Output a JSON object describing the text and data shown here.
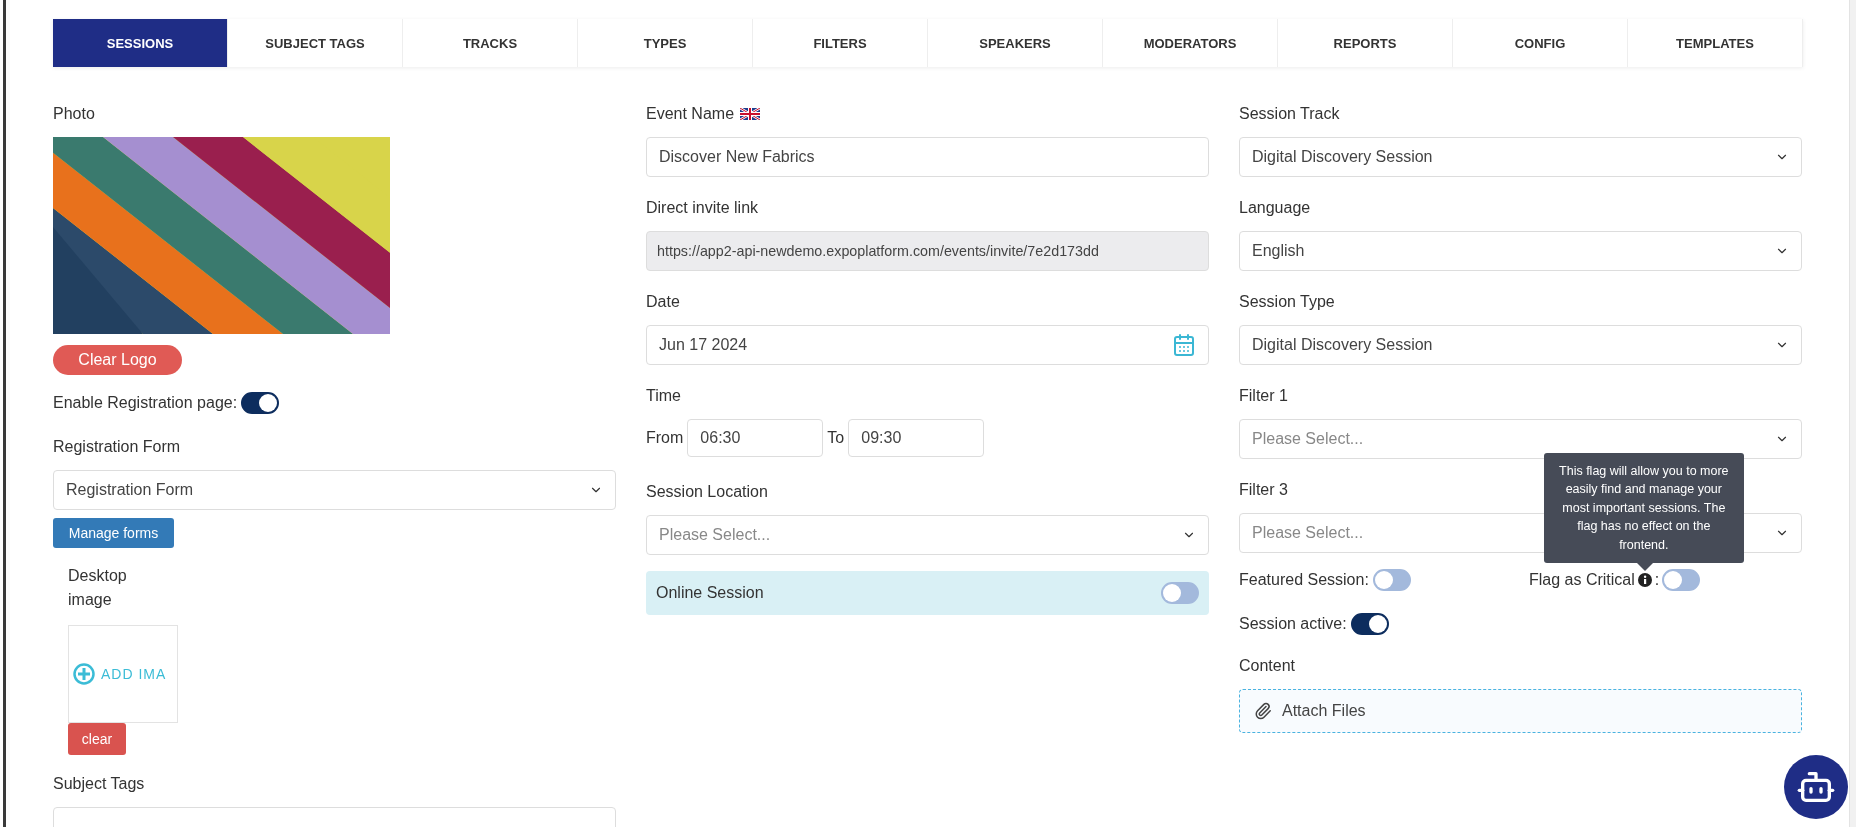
{
  "tabs": [
    {
      "label": "SESSIONS",
      "selected": true
    },
    {
      "label": "SUBJECT TAGS",
      "selected": false
    },
    {
      "label": "TRACKS",
      "selected": false
    },
    {
      "label": "TYPES",
      "selected": false
    },
    {
      "label": "FILTERS",
      "selected": false
    },
    {
      "label": "SPEAKERS",
      "selected": false
    },
    {
      "label": "MODERATORS",
      "selected": false
    },
    {
      "label": "REPORTS",
      "selected": false
    },
    {
      "label": "CONFIG",
      "selected": false
    },
    {
      "label": "TEMPLATES",
      "selected": false
    }
  ],
  "left": {
    "photo_label": "Photo",
    "clear_logo_button": "Clear Logo",
    "registration_toggle": {
      "label": "Enable Registration page:",
      "on": true
    },
    "registration_form": {
      "label": "Registration Form",
      "value": "Registration Form"
    },
    "manage_forms_button": "Manage forms",
    "desktop_image": {
      "label": "Desktop image",
      "add_text": "ADD IMA",
      "clear_button": "clear"
    },
    "subject_tags_label": "Subject Tags"
  },
  "middle": {
    "event_name": {
      "label": "Event Name",
      "value": "Discover New Fabrics"
    },
    "invite_link": {
      "label": "Direct invite link",
      "value": "https://app2-api-newdemo.expoplatform.com/events/invite/7e2d173dd"
    },
    "date": {
      "label": "Date",
      "value": "Jun 17 2024"
    },
    "time": {
      "label": "Time",
      "from_label": "From",
      "from": "06:30",
      "to_label": "To",
      "to": "09:30"
    },
    "location": {
      "label": "Session Location",
      "placeholder": "Please Select..."
    },
    "online_session": {
      "label": "Online Session",
      "on": false
    }
  },
  "right": {
    "selects": [
      {
        "label": "Session Track",
        "value": "Digital Discovery Session"
      },
      {
        "label": "Language",
        "value": "English"
      },
      {
        "label": "Session Type",
        "value": "Digital Discovery Session"
      },
      {
        "label": "Filter 1",
        "placeholder": "Please Select..."
      },
      {
        "label": "Filter 3",
        "placeholder": "Please Select..."
      }
    ],
    "featured": {
      "label": "Featured Session:",
      "on": false
    },
    "critical": {
      "label": "Flag as Critical",
      "colon": ":",
      "on": false,
      "tooltip": "This flag will allow you to more easily find and manage your most important sessions. The flag has no effect on the frontend."
    },
    "active": {
      "label": "Session active:",
      "on": true
    },
    "content_label": "Content",
    "attach": "Attach Files"
  }
}
